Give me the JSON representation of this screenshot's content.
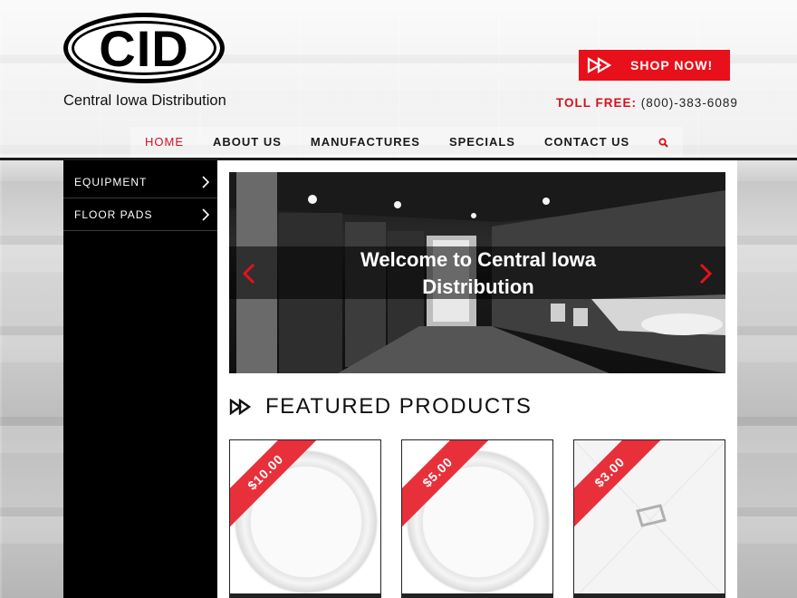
{
  "brand": {
    "logo_text": "CID",
    "tagline": "Central Iowa Distribution"
  },
  "header": {
    "shop_button": "SHOP NOW!",
    "toll_label": "TOLL FREE:",
    "toll_number": "(800)-383-6089"
  },
  "nav": {
    "items": [
      "HOME",
      "ABOUT US",
      "MANUFACTURES",
      "SPECIALS",
      "CONTACT US"
    ],
    "active": "HOME",
    "search_icon": "search-icon"
  },
  "sidebar": {
    "items": [
      {
        "label": "EQUIPMENT",
        "icon": "chevron-right-icon"
      },
      {
        "label": "FLOOR PADS",
        "icon": "chevron-right-icon"
      }
    ]
  },
  "slider": {
    "caption": "Welcome to Central Iowa Distribution",
    "prev_icon": "chevron-left-icon",
    "next_icon": "chevron-right-icon"
  },
  "featured": {
    "title": "FEATURED PRODUCTS",
    "products": [
      {
        "price": "$10.00",
        "image": "paper-plate"
      },
      {
        "price": "$5.00",
        "image": "paper-plate"
      },
      {
        "price": "$3.00",
        "image": "placeholder-image"
      }
    ]
  },
  "colors": {
    "accent": "#e8101a",
    "dark": "#000000"
  }
}
